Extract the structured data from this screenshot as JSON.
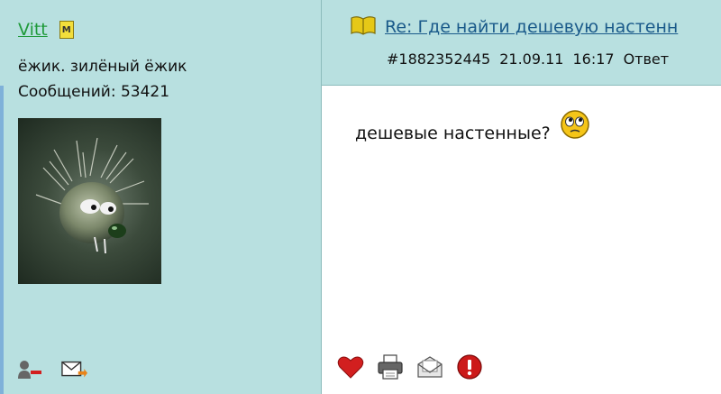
{
  "sidebar": {
    "author_name": "Vitt",
    "mod_badge": "M",
    "user_status": "ёжик. зилёный ёжик",
    "post_count_label": "Сообщений: 53421",
    "actions": [
      {
        "name": "add-friend",
        "icon": "user-minus-icon"
      },
      {
        "name": "send-message",
        "icon": "mail-forward-icon"
      }
    ]
  },
  "post": {
    "thread_title": "Re: Где найти дешевую настенн",
    "post_id": "#1882352445",
    "date": "21.09.11",
    "time": "16:17",
    "reply_label": "Ответ",
    "message": "дешевые настенные?",
    "smiley": "confused-smiley-icon"
  },
  "post_actions": [
    {
      "name": "like",
      "icon": "heart-icon"
    },
    {
      "name": "print",
      "icon": "printer-icon"
    },
    {
      "name": "email",
      "icon": "envelope-icon"
    },
    {
      "name": "report",
      "icon": "exclamation-icon"
    }
  ],
  "colors": {
    "panel_bg": "#b8e0e0",
    "content_bg": "#ffffff",
    "author_link": "#1f9a3a",
    "thread_link": "#1a5a8a",
    "badge_yellow": "#f2de3b",
    "heart_red": "#d21f1f",
    "report_red": "#cc1a1a"
  }
}
